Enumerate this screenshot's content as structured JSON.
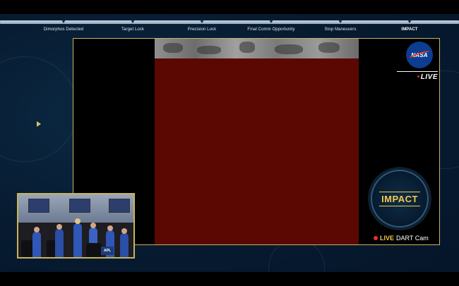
{
  "timeline": {
    "milestones": [
      {
        "label": "Dimorphos Detected"
      },
      {
        "label": "Target Lock"
      },
      {
        "label": "Precision Lock"
      },
      {
        "label": "Final Comm Opportunity"
      },
      {
        "label": "Stop Maneuvers"
      },
      {
        "label": "IMPACT"
      }
    ]
  },
  "broadcast": {
    "logo_text": "NASA",
    "live_label": "LIVE",
    "impact_badge": "IMPACT",
    "cam_live": "LIVE",
    "cam_name": "DART Cam"
  },
  "pip": {
    "logo_text": "APL"
  },
  "colors": {
    "accent_gold": "#f2c94c",
    "frame_border": "#c9b45c",
    "live_red": "#e8332a",
    "feed_red": "#5b0803",
    "nasa_blue": "#0b3d91"
  }
}
